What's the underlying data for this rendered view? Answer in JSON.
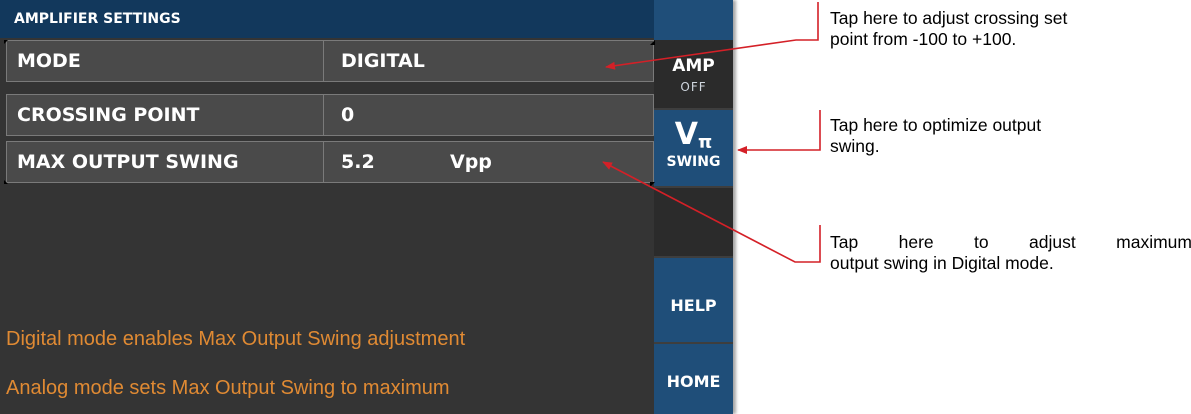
{
  "title": "AMPLIFIER SETTINGS",
  "rows": [
    {
      "label": "MODE",
      "value": "DIGITAL",
      "unit": ""
    },
    {
      "label": "CROSSING POINT",
      "value": "0",
      "unit": ""
    },
    {
      "label": "MAX OUTPUT SWING",
      "value": "5.2",
      "unit": "Vpp"
    }
  ],
  "messages": [
    "Digital mode enables Max Output Swing adjustment",
    "Analog mode sets Max Output Swing to maximum"
  ],
  "side_buttons": {
    "amp": {
      "label": "AMP",
      "state": "OFF"
    },
    "vpi": {
      "symbol": "V",
      "subscript": "π",
      "label": "SWING"
    },
    "help": "HELP",
    "home": "HOME"
  },
  "annotations": {
    "crossing_line1": "Tap here to adjust crossing set",
    "crossing_line2": "point from -100 to +100.",
    "swing_line1": "Tap here to optimize output",
    "swing_line2": "swing.",
    "max_line1": "Tap here to adjust maximum",
    "max_line2": "output swing in Digital mode."
  },
  "colors": {
    "title_bar": "#12385c",
    "panel_background": "#343434",
    "row_background": "#4a4a4a",
    "side_panel": "#1f4e79",
    "message_text": "#e08a33",
    "annotation_arrow": "#d42027"
  },
  "icons": {
    "arrow": "red-callout-arrow",
    "corner": "corner-triangle"
  }
}
